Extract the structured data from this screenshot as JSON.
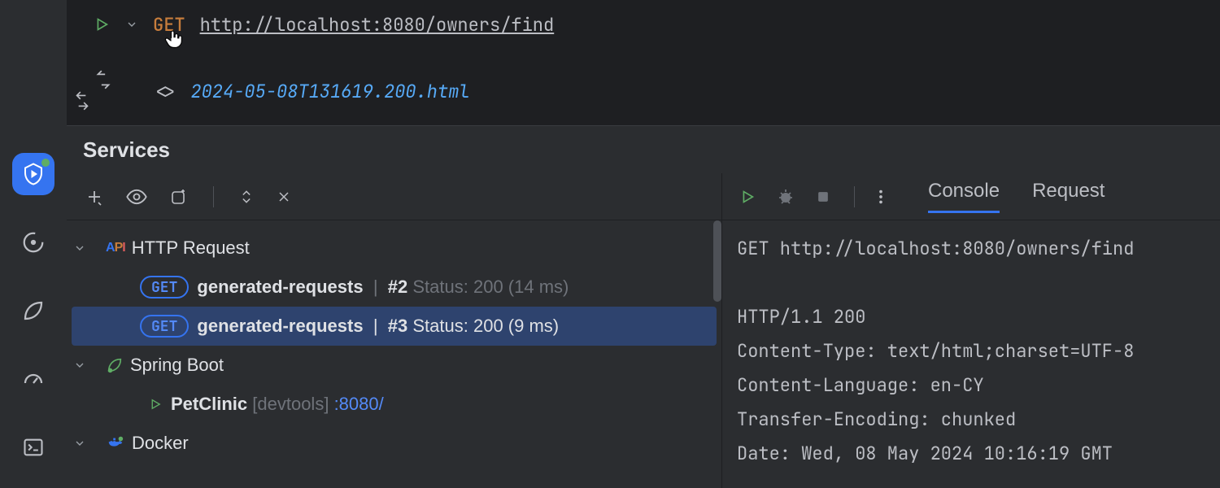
{
  "editor": {
    "method": "GET",
    "url": "http://localhost:8080/owners/find",
    "response_file": "2024-05-08T131619.200.html"
  },
  "panel": {
    "title": "Services"
  },
  "tree": {
    "http_label": "HTTP Request",
    "items": [
      {
        "pill": "GET",
        "name": "generated-requests",
        "seq": "#2",
        "status": "Status: 200 (14 ms)"
      },
      {
        "pill": "GET",
        "name": "generated-requests",
        "seq": "#3",
        "status": "Status: 200 (9 ms)"
      }
    ],
    "spring_label": "Spring Boot",
    "spring_app": "PetClinic",
    "spring_tag": "[devtools]",
    "spring_port": ":8080/",
    "docker_label": "Docker"
  },
  "tabs": {
    "console": "Console",
    "request": "Request"
  },
  "console_lines": [
    "GET http://localhost:8080/owners/find",
    "",
    "HTTP/1.1 200 ",
    "Content-Type: text/html;charset=UTF-8",
    "Content-Language: en-CY",
    "Transfer-Encoding: chunked",
    "Date: Wed, 08 May 2024 10:16:19 GMT"
  ]
}
